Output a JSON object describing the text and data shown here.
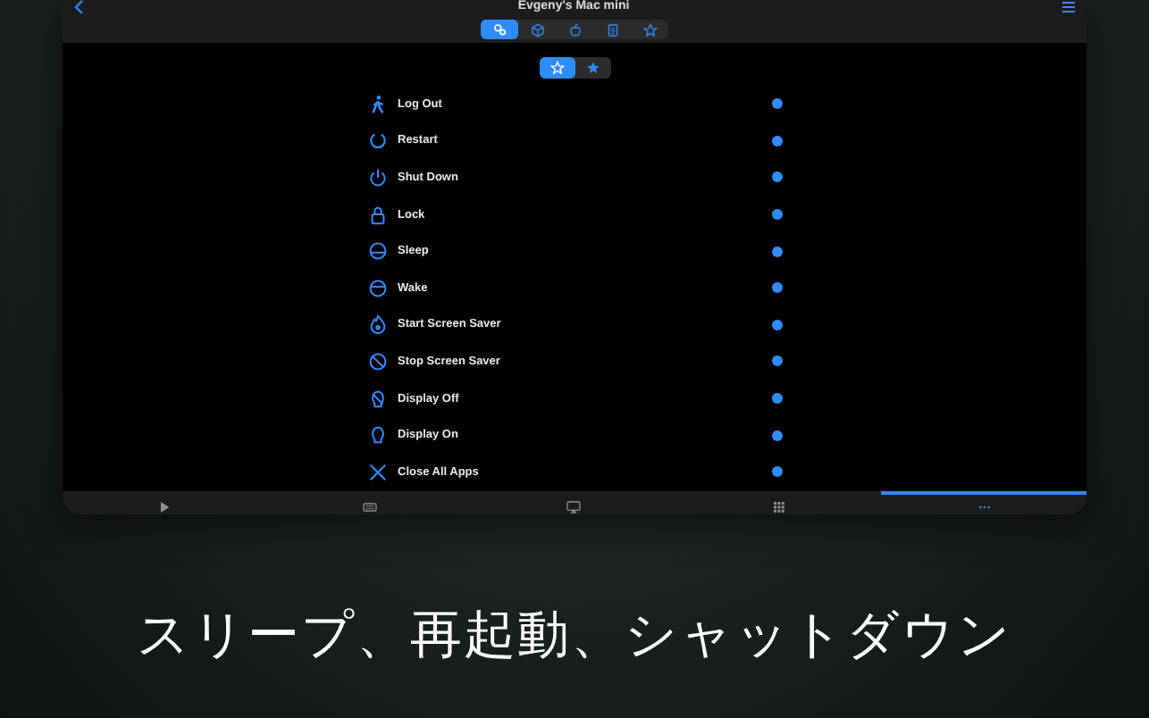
{
  "header": {
    "title": "Evgeny's Mac mini"
  },
  "mode_segments": [
    {
      "selected": true
    },
    {
      "selected": false
    },
    {
      "selected": false
    },
    {
      "selected": false
    },
    {
      "selected": false
    }
  ],
  "filter_segments": [
    {
      "selected": true
    },
    {
      "selected": false
    }
  ],
  "actions": [
    {
      "label": "Log Out"
    },
    {
      "label": "Restart"
    },
    {
      "label": "Shut Down"
    },
    {
      "label": "Lock"
    },
    {
      "label": "Sleep"
    },
    {
      "label": "Wake"
    },
    {
      "label": "Start Screen Saver"
    },
    {
      "label": "Stop Screen Saver"
    },
    {
      "label": "Display Off"
    },
    {
      "label": "Display On"
    },
    {
      "label": "Close All Apps"
    }
  ],
  "tab_bar": [
    {
      "selected": false
    },
    {
      "selected": false
    },
    {
      "selected": false
    },
    {
      "selected": false
    },
    {
      "selected": true
    }
  ],
  "caption": "スリープ、再起動、シャットダウン"
}
